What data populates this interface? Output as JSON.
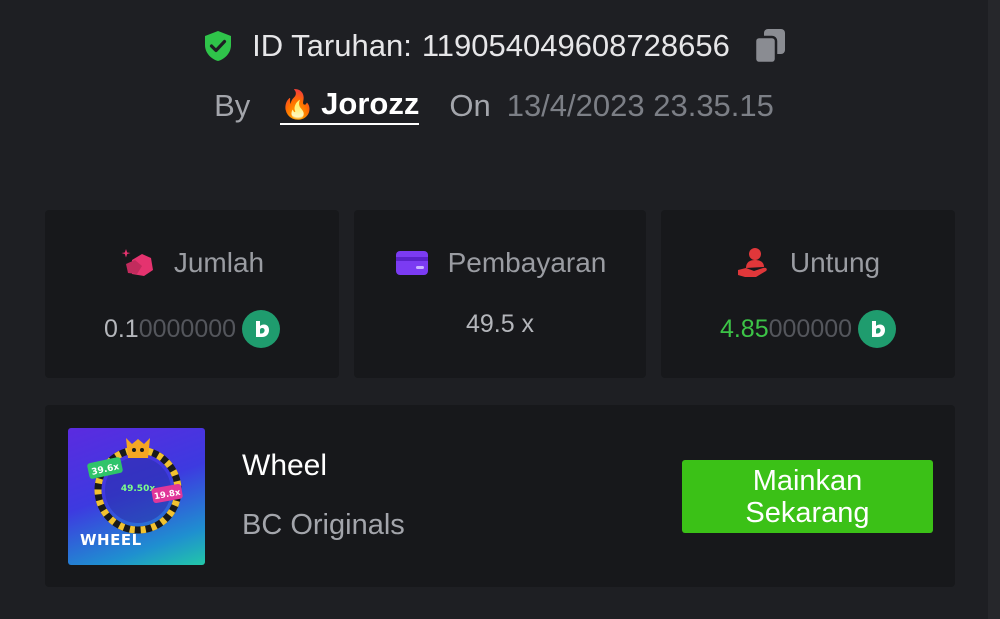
{
  "header": {
    "bet_id_label": "ID Taruhan:",
    "bet_id_value": "119054049608728656",
    "by_label": "By",
    "user_emoji": "🔥",
    "username": "Jorozz",
    "on_label": "On",
    "datetime": "13/4/2023 23.35.15"
  },
  "stats": {
    "amount": {
      "label": "Jumlah",
      "value_main": "0.1",
      "value_dim": "0000000",
      "icon": "money-bag-icon"
    },
    "payout": {
      "label": "Pembayaran",
      "value": "49.5 x",
      "icon": "card-icon"
    },
    "profit": {
      "label": "Untung",
      "value_main": "4.85",
      "value_dim": "000000",
      "icon": "hand-person-icon"
    }
  },
  "game": {
    "title": "Wheel",
    "provider": "BC Originals",
    "thumb_word": "WHEEL",
    "thumb_multipliers": [
      "39.6x",
      "49.50x",
      "19.8x"
    ],
    "play_label": "Mainkan Sekarang"
  },
  "colors": {
    "background": "#1e1f23",
    "card": "#17181b",
    "accent_green": "#3bc117",
    "profit_green": "#3cc447",
    "coin": "#1f9c6e"
  }
}
